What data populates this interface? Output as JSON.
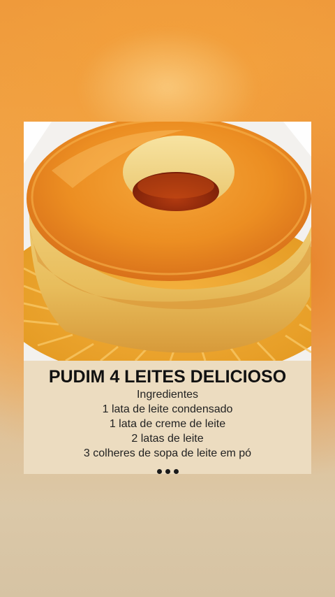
{
  "post": {
    "title": "PUDIM 4 LEITES DELICIOSO",
    "ingredients_heading": "Ingredientes",
    "ingredients": [
      "1 lata de leite condensado",
      "1 lata de creme de leite",
      "2 latas de leite",
      "3 colheres de sopa de leite em pó"
    ],
    "more_icon": "more-dots-icon",
    "photo_subject": "pudim-photo"
  },
  "colors": {
    "background_orange": "#f2a545",
    "background_beige": "#d6c3a3",
    "text_panel": "#ecdcc0",
    "caramel": "#e58a1f",
    "custard": "#e9c36a"
  }
}
